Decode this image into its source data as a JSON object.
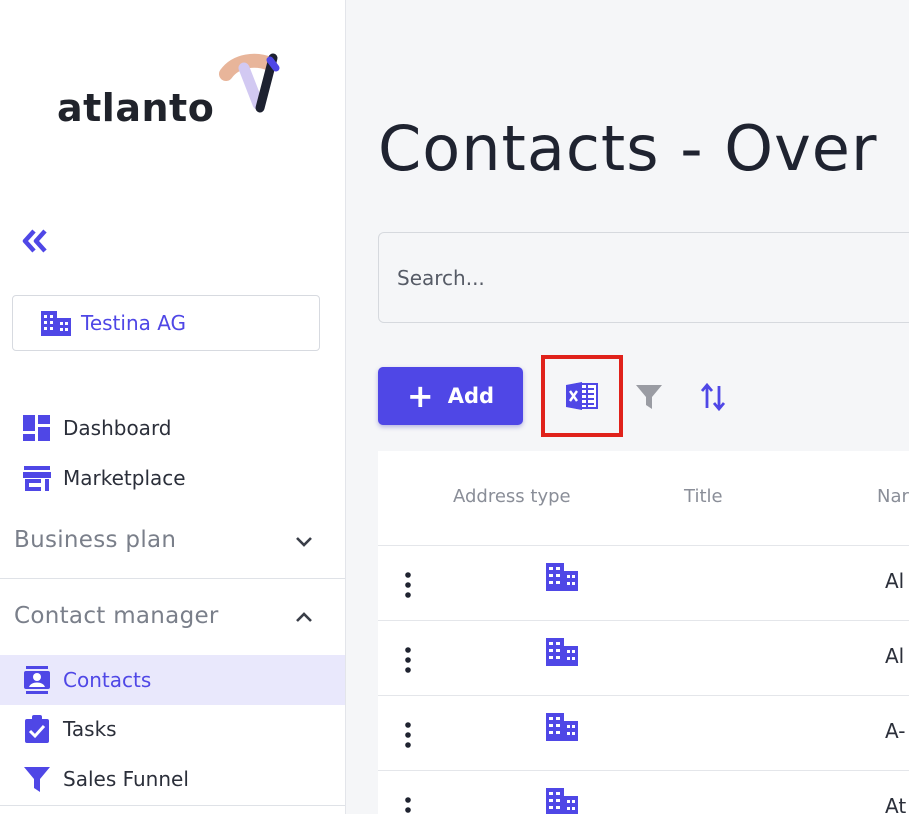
{
  "app": {
    "logo_text": "atlanto"
  },
  "sidebar": {
    "company": "Testina AG",
    "nav_top": [
      {
        "label": "Dashboard",
        "icon": "dashboard-icon"
      },
      {
        "label": "Marketplace",
        "icon": "store-icon"
      }
    ],
    "sections": [
      {
        "label": "Business plan",
        "expanded": false
      },
      {
        "label": "Contact manager",
        "expanded": true
      }
    ],
    "contact_items": [
      {
        "label": "Contacts",
        "icon": "contact-card-icon",
        "active": true
      },
      {
        "label": "Tasks",
        "icon": "clipboard-check-icon",
        "active": false
      },
      {
        "label": "Sales Funnel",
        "icon": "funnel-icon",
        "active": false
      }
    ]
  },
  "main": {
    "title": "Contacts - Over",
    "search_placeholder": "Search...",
    "add_label": "Add",
    "columns": [
      "Address type",
      "Title",
      "Nar"
    ],
    "rows": [
      {
        "name": "Al"
      },
      {
        "name": "Al"
      },
      {
        "name": "A-"
      },
      {
        "name": "At"
      }
    ]
  },
  "colors": {
    "accent": "#4f47e6",
    "highlight_box": "#e0221b",
    "active_nav_bg": "#e9e8fc"
  }
}
